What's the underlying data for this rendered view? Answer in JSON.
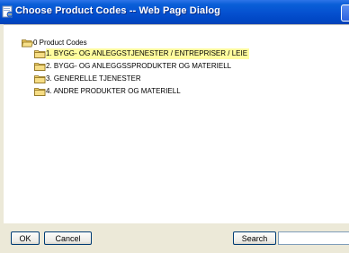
{
  "window": {
    "title": "Choose Product Codes -- Web Page Dialog"
  },
  "tree": {
    "root": {
      "label": "0 Product Codes",
      "icon": "folder-open-icon"
    },
    "children": [
      {
        "label": "1. BYGG- OG ANLEGGSTJENESTER / ENTREPRISER / LEIE",
        "icon": "folder-icon",
        "selected": true
      },
      {
        "label": "2. BYGG- OG ANLEGGSSPRODUKTER OG MATERIELL",
        "icon": "folder-icon",
        "selected": false
      },
      {
        "label": "3. GENERELLE TJENESTER",
        "icon": "folder-icon",
        "selected": false
      },
      {
        "label": "4. ANDRE PRODUKTER OG MATERIELL",
        "icon": "folder-icon",
        "selected": false
      }
    ]
  },
  "footer": {
    "ok_label": "OK",
    "cancel_label": "Cancel",
    "search_label": "Search",
    "search_value": ""
  },
  "colors": {
    "titlebar": "#0550cf",
    "dialog_face": "#ece9d8",
    "selection_highlight": "#fffc9e",
    "folder_yellow": "#f3d36b"
  }
}
